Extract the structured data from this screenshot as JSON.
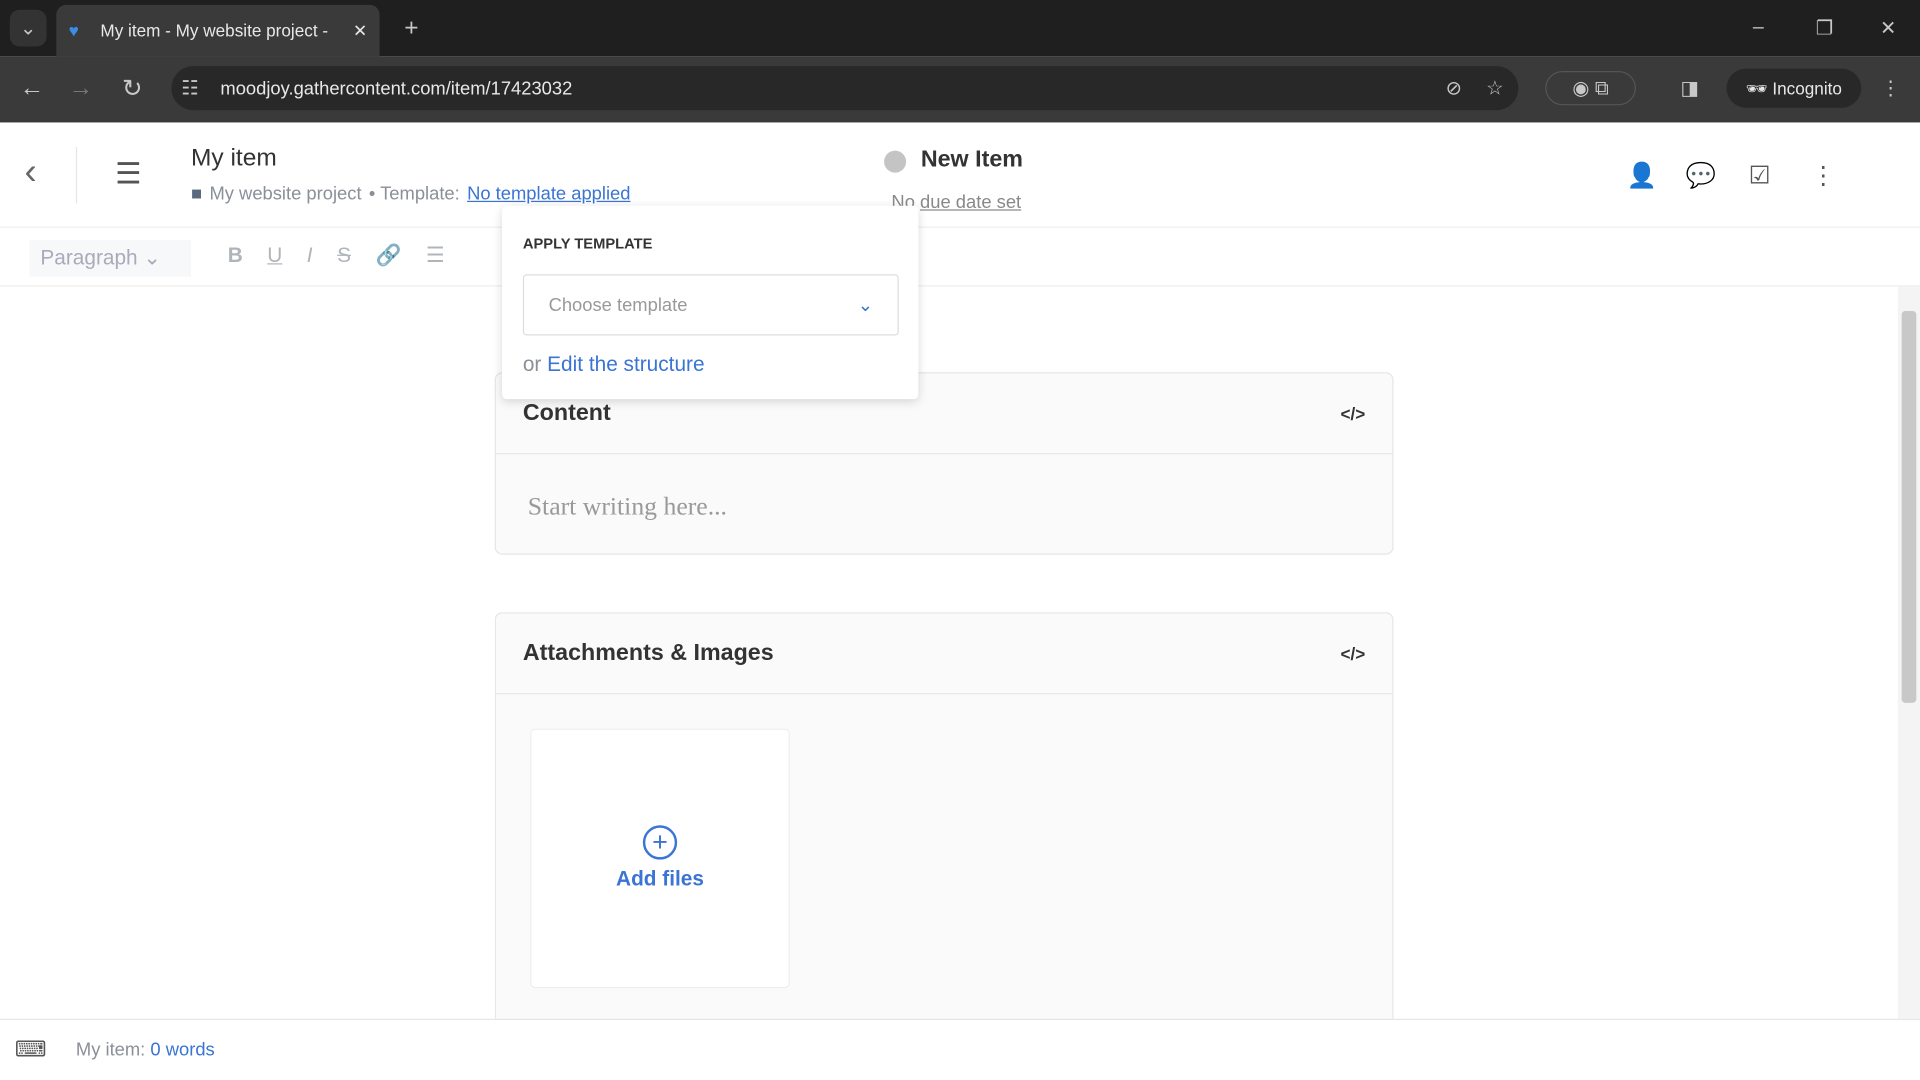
{
  "browser": {
    "tab_title": "My item - My website project -",
    "url": "moodjoy.gathercontent.com/item/17423032",
    "profile": "Incognito"
  },
  "header": {
    "title": "My item",
    "project": "My website project",
    "template_label": "• Template:",
    "template_link": "No template applied",
    "status": "New Item",
    "due_prefix": "No",
    "due_link": "due date set"
  },
  "editor": {
    "paragraph": "Paragraph"
  },
  "popup": {
    "heading": "APPLY TEMPLATE",
    "select_placeholder": "Choose template",
    "or": "or",
    "edit_link": "Edit the structure"
  },
  "content": {
    "title": "Content",
    "placeholder": "Start writing here..."
  },
  "attachments": {
    "title": "Attachments & Images",
    "add_files": "Add files"
  },
  "footer": {
    "label": "My item:",
    "words": "0 words"
  },
  "colors": {
    "accent": "#3a74d4",
    "status_dot": "#c4c4c4"
  }
}
